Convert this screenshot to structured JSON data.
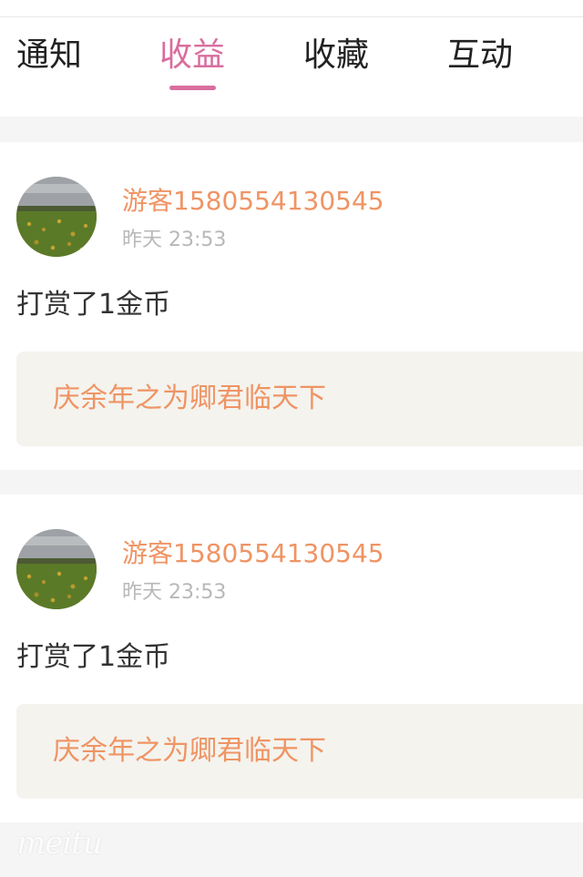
{
  "tabs": [
    {
      "label": "通知",
      "active": false
    },
    {
      "label": "收益",
      "active": true
    },
    {
      "label": "收藏",
      "active": false
    },
    {
      "label": "互动",
      "active": false
    }
  ],
  "items": [
    {
      "username": "游客1580554130545",
      "time": "昨天 23:53",
      "action": "打赏了1金币",
      "book_title": "庆余年之为卿君临天下"
    },
    {
      "username": "游客1580554130545",
      "time": "昨天 23:53",
      "action": "打赏了1金币",
      "book_title": "庆余年之为卿君临天下"
    }
  ],
  "watermark": "meitu",
  "colors": {
    "accent": "#d96d9e",
    "username": "#ef9464",
    "background": "#f6f5f5",
    "book_box": "#f4f3ee"
  }
}
